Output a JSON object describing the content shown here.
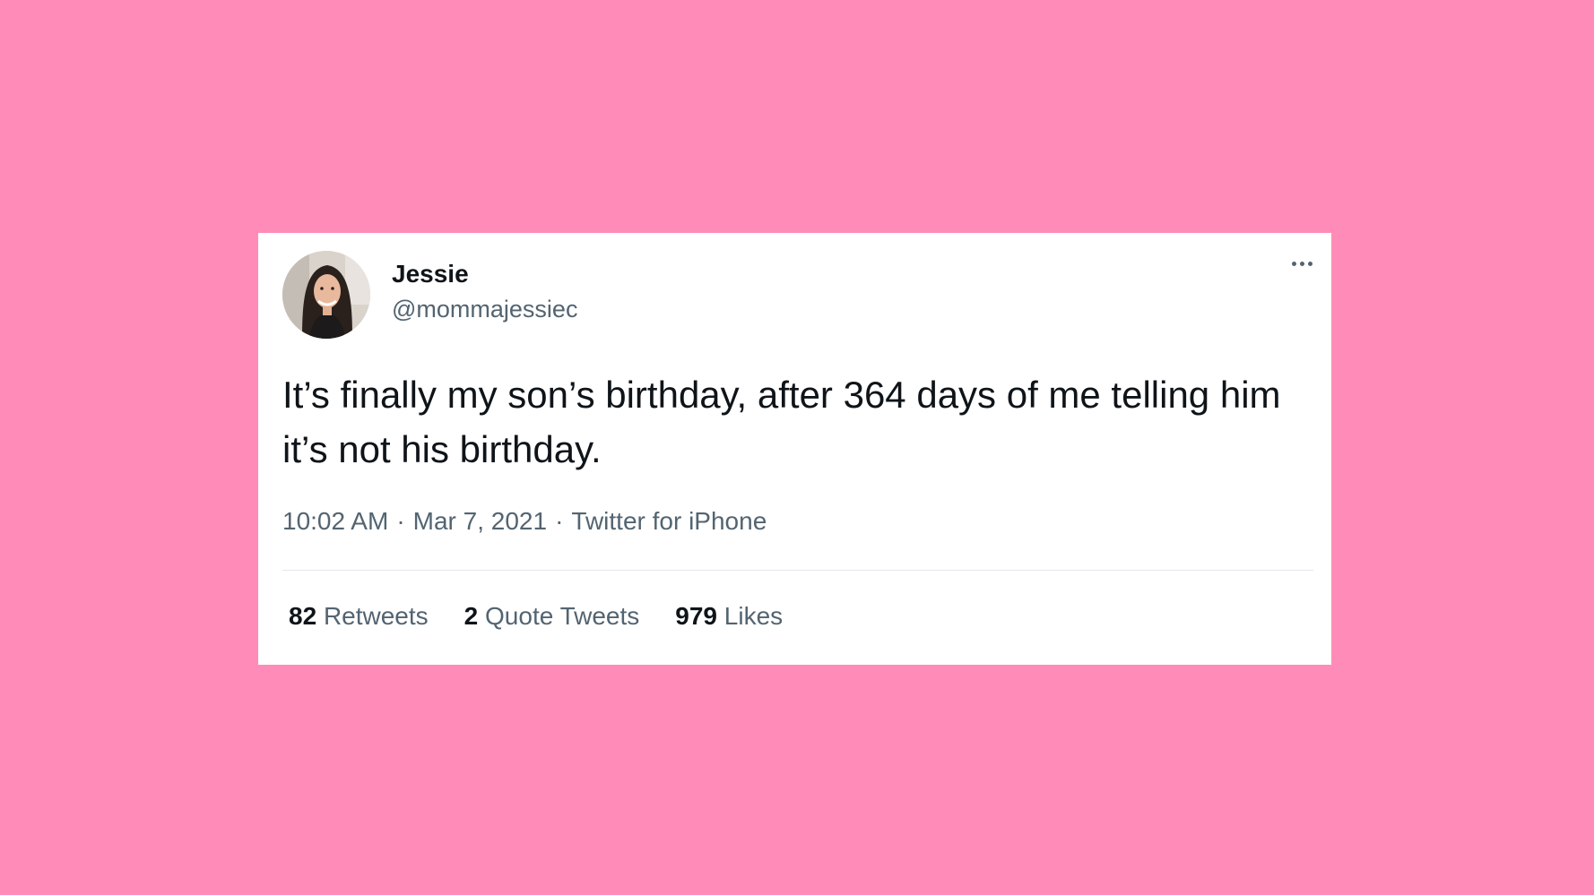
{
  "colors": {
    "background": "#ff8cb8",
    "card": "#ffffff",
    "primary_text": "#0f1419",
    "secondary_text": "#536471",
    "divider": "#e3e7ea"
  },
  "author": {
    "display_name": "Jessie",
    "handle": "@mommajessiec",
    "avatar_icon": "profile-photo"
  },
  "tweet": {
    "text": "It’s finally my son’s birthday, after 364 days of me telling him it’s not his birthday.",
    "time": "10:02 AM",
    "date": "Mar 7, 2021",
    "source": "Twitter for iPhone",
    "separator": "·"
  },
  "stats": {
    "retweets_count": "82",
    "retweets_label": "Retweets",
    "quotes_count": "2",
    "quotes_label": "Quote Tweets",
    "likes_count": "979",
    "likes_label": "Likes"
  },
  "more_icon": "more-horizontal-icon"
}
